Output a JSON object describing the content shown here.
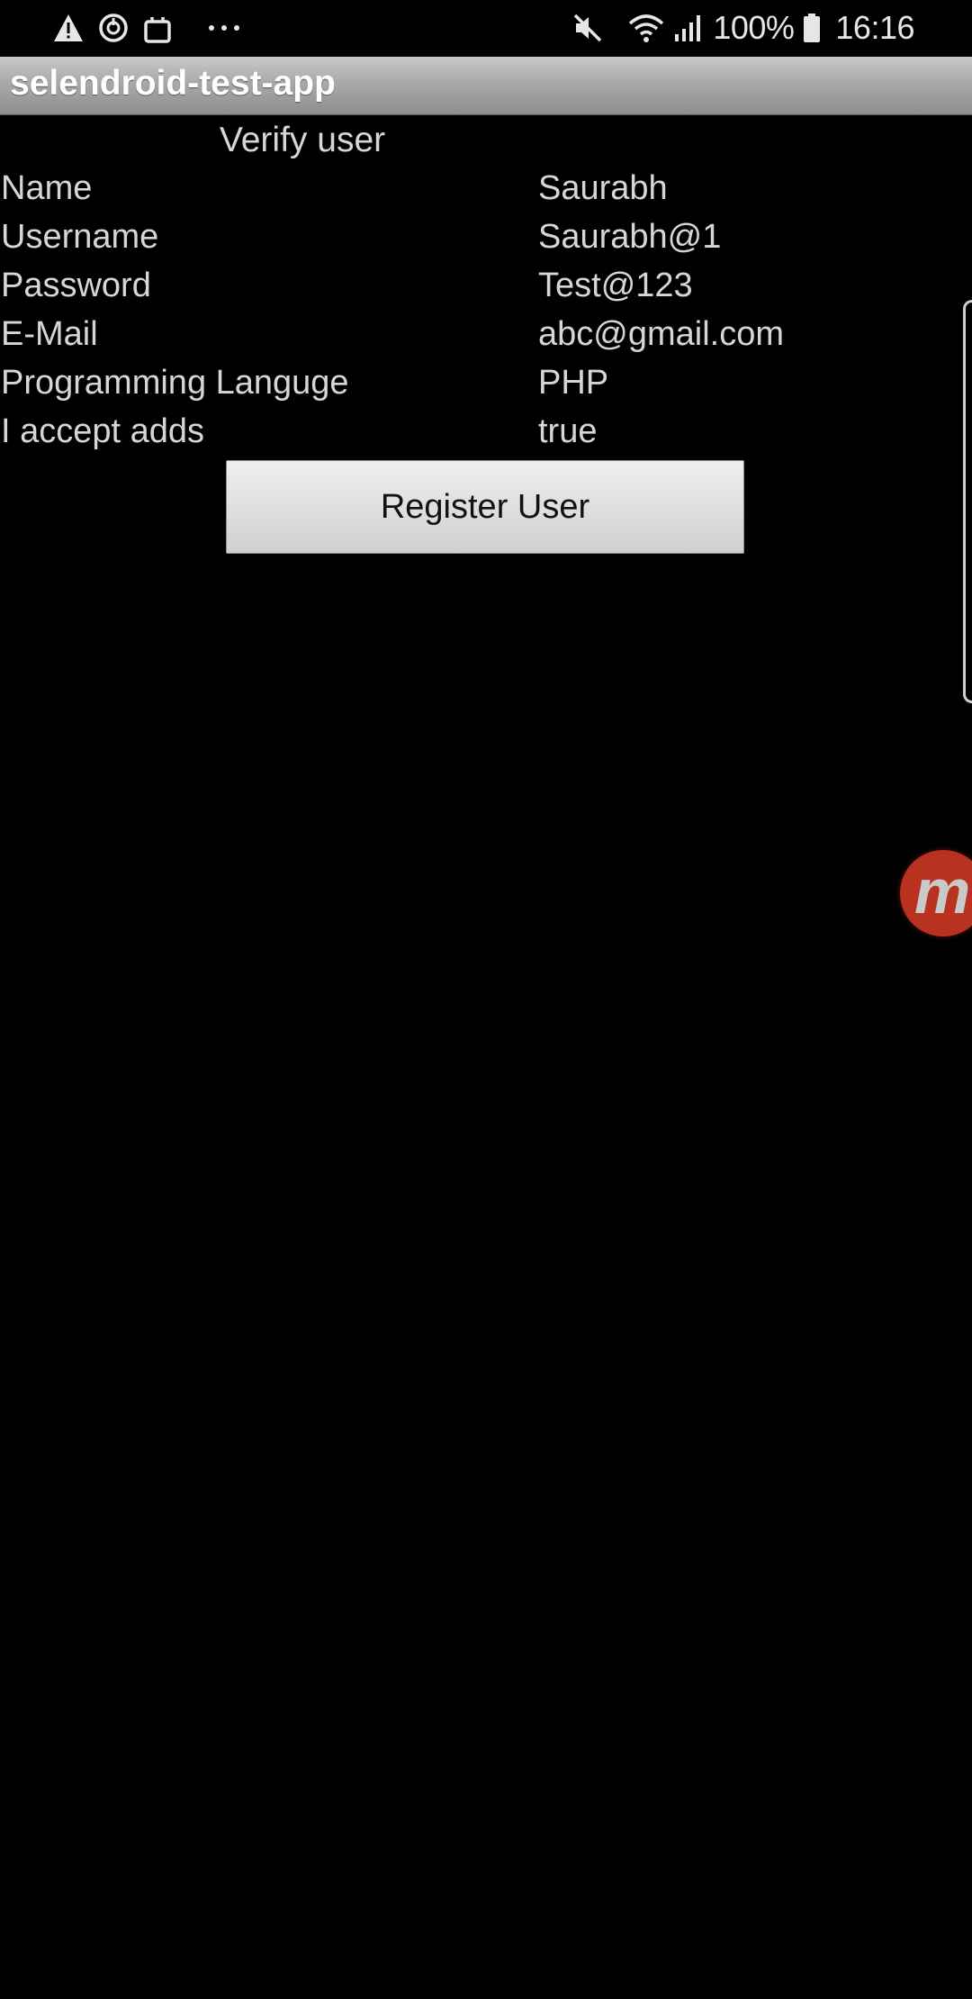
{
  "status_bar": {
    "battery_percent": "100%",
    "time": "16:16",
    "left_icons": [
      "warning-icon",
      "sync-icon",
      "shopping-bag-icon",
      "more-dots-icon"
    ],
    "right_icons": [
      "mute-icon",
      "wifi-icon",
      "signal-icon",
      "battery-icon"
    ]
  },
  "app": {
    "title": "selendroid-test-app"
  },
  "screen": {
    "heading": "Verify user",
    "fields": [
      {
        "label": "Name",
        "value": "Saurabh"
      },
      {
        "label": "Username",
        "value": "Saurabh@1"
      },
      {
        "label": "Password",
        "value": "Test@123"
      },
      {
        "label": "E-Mail",
        "value": "abc@gmail.com"
      },
      {
        "label": "Programming Languge",
        "value": "PHP"
      },
      {
        "label": "I accept adds",
        "value": "true"
      }
    ],
    "register_button_label": "Register User"
  },
  "overlay": {
    "badge_letter": "m",
    "badge_color": "#b8321f"
  },
  "colors": {
    "background": "#000000",
    "text": "#d6d6d6",
    "action_bar_gradient": [
      "#c9c9c9",
      "#8e8e8e"
    ]
  }
}
